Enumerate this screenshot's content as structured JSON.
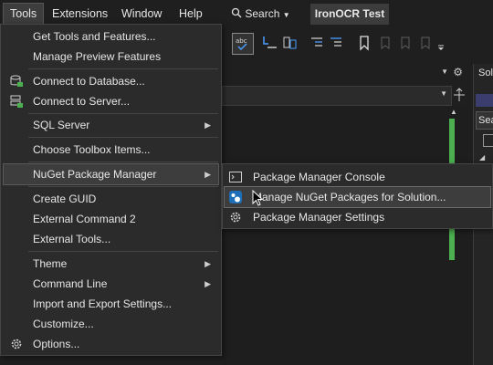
{
  "menubar": {
    "items": [
      "Tools",
      "Extensions",
      "Window",
      "Help"
    ],
    "search_label": "Search",
    "project_title": "IronOCR Test"
  },
  "side_pane": {
    "title_fragment": "Solu",
    "search_fragment": "Sea"
  },
  "tools_menu": {
    "items": [
      {
        "label": "Get Tools and Features...",
        "icon": "none"
      },
      {
        "label": "Manage Preview Features",
        "icon": "none"
      },
      {
        "label": "Connect to Database...",
        "icon": "database-connect-icon"
      },
      {
        "label": "Connect to Server...",
        "icon": "server-connect-icon"
      },
      {
        "label": "SQL Server",
        "icon": "none",
        "submenu": true
      },
      {
        "label": "Choose Toolbox Items...",
        "icon": "none"
      },
      {
        "label": "NuGet Package Manager",
        "icon": "none",
        "submenu": true,
        "highlighted": true
      },
      {
        "label": "Create GUID",
        "icon": "none"
      },
      {
        "label": "External Command 2",
        "icon": "none"
      },
      {
        "label": "External Tools...",
        "icon": "none"
      },
      {
        "label": "Theme",
        "icon": "none",
        "submenu": true
      },
      {
        "label": "Command Line",
        "icon": "none",
        "submenu": true
      },
      {
        "label": "Import and Export Settings...",
        "icon": "none"
      },
      {
        "label": "Customize...",
        "icon": "none"
      },
      {
        "label": "Options...",
        "icon": "gear-icon"
      }
    ]
  },
  "nuget_submenu": {
    "items": [
      {
        "label": "Package Manager Console",
        "icon": "console-icon"
      },
      {
        "label": "Manage NuGet Packages for Solution...",
        "icon": "nuget-icon",
        "highlighted": true
      },
      {
        "label": "Package Manager Settings",
        "icon": "gear-icon"
      }
    ]
  },
  "colors": {
    "menu_bg": "#2b2b2b",
    "highlight": "#3d3d3d",
    "accent_green": "#4caf50",
    "app_bg": "#1f1f1f"
  }
}
